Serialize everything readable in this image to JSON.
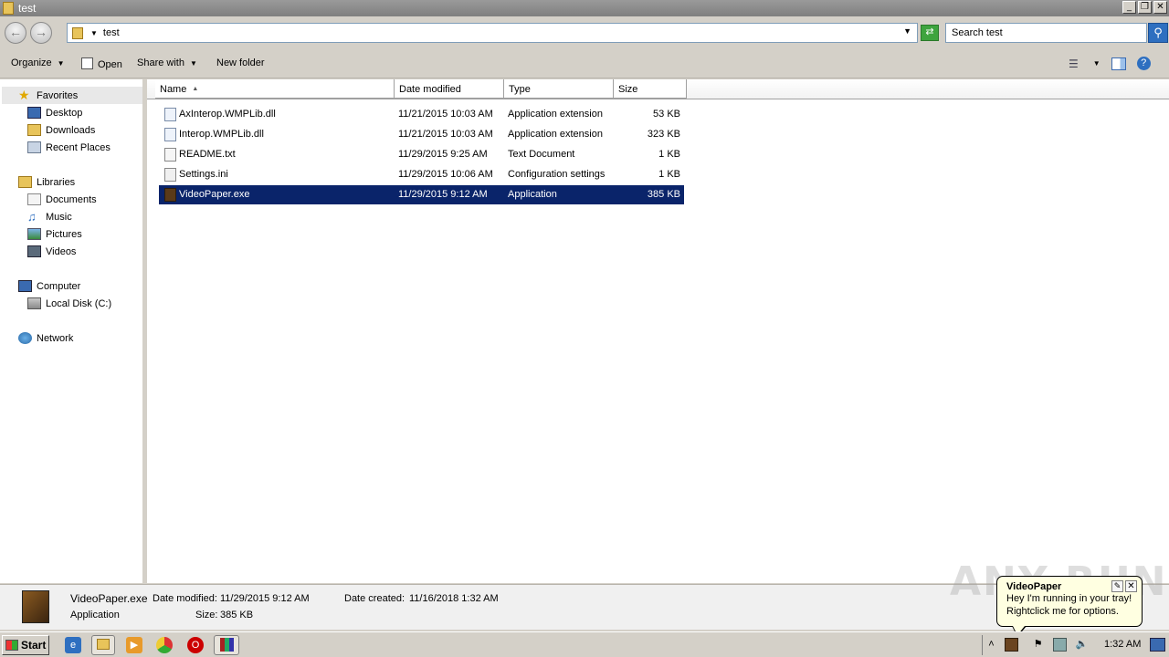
{
  "window": {
    "title": "test",
    "buttons": {
      "minimize": "_",
      "restore": "❐",
      "close": "✕"
    }
  },
  "address": {
    "path": "test",
    "search_placeholder": "Search test"
  },
  "toolbar": {
    "organize": "Organize",
    "open": "Open",
    "share_with": "Share with",
    "new_folder": "New folder"
  },
  "nav": {
    "favorites": "Favorites",
    "desktop": "Desktop",
    "downloads": "Downloads",
    "recent_places": "Recent Places",
    "libraries": "Libraries",
    "documents": "Documents",
    "music": "Music",
    "pictures": "Pictures",
    "videos": "Videos",
    "computer": "Computer",
    "local_disk": "Local Disk (C:)",
    "network": "Network"
  },
  "columns": {
    "name": "Name",
    "date_modified": "Date modified",
    "type": "Type",
    "size": "Size"
  },
  "files": [
    {
      "name": "AxInterop.WMPLib.dll",
      "date": "11/21/2015 10:03 AM",
      "type": "Application extension",
      "size": "53 KB"
    },
    {
      "name": "Interop.WMPLib.dll",
      "date": "11/21/2015 10:03 AM",
      "type": "Application extension",
      "size": "323 KB"
    },
    {
      "name": "README.txt",
      "date": "11/29/2015 9:25 AM",
      "type": "Text Document",
      "size": "1 KB"
    },
    {
      "name": "Settings.ini",
      "date": "11/29/2015 10:06 AM",
      "type": "Configuration settings",
      "size": "1 KB"
    },
    {
      "name": "VideoPaper.exe",
      "date": "11/29/2015 9:12 AM",
      "type": "Application",
      "size": "385 KB"
    }
  ],
  "details": {
    "name": "VideoPaper.exe",
    "type": "Application",
    "date_modified_label": "Date modified:",
    "date_modified": "11/29/2015 9:12 AM",
    "date_created_label": "Date created:",
    "date_created": "11/16/2018 1:32 AM",
    "size_label": "Size:",
    "size": "385 KB"
  },
  "taskbar": {
    "start": "Start",
    "clock": "1:32 AM"
  },
  "balloon": {
    "title": "VideoPaper",
    "line1": "Hey I'm running in your tray!",
    "line2": "Rightclick me for options."
  },
  "colors": {
    "selection": "#0a246a",
    "window_bg": "#d4d0c8",
    "balloon_bg": "#ffffe1"
  }
}
